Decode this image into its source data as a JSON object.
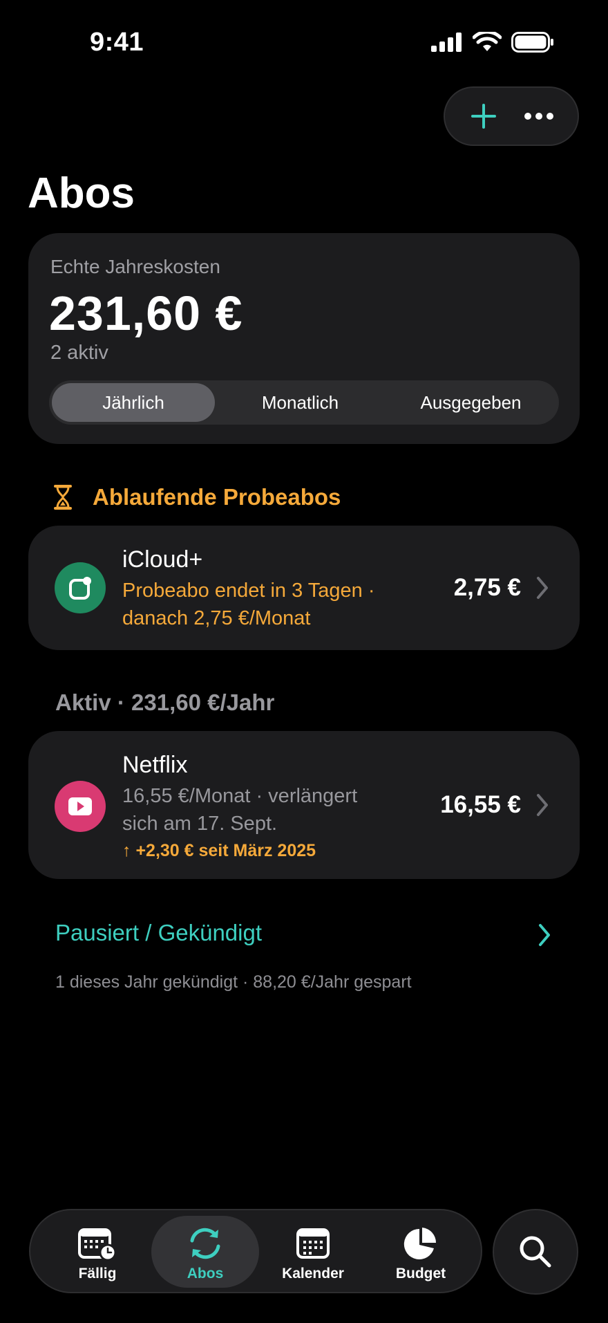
{
  "status_bar": {
    "time": "9:41"
  },
  "header": {
    "title": "Abos"
  },
  "summary": {
    "label": "Echte Jahreskosten",
    "amount": "231,60 €",
    "active_count": "2 aktiv",
    "segments": [
      "Jährlich",
      "Monatlich",
      "Ausgegeben"
    ],
    "selected_segment": "Jährlich"
  },
  "trials": {
    "title": "Ablaufende Probeabos",
    "items": [
      {
        "name": "iCloud+",
        "line1": "Probeabo endet in 3 Tagen ·",
        "line2": "danach 2,75 €/Monat",
        "price": "2,75 €",
        "icon": "icloud-icon",
        "color": "#1f8a5f"
      }
    ]
  },
  "active": {
    "title": "Aktiv · 231,60 €/Jahr",
    "items": [
      {
        "name": "Netflix",
        "line1": "16,55 €/Monat · verlängert",
        "line2": "sich am 17. Sept.",
        "increase": "↑ +2,30 € seit März 2025",
        "price": "16,55 €",
        "icon": "play-icon",
        "color": "#d93a72"
      }
    ]
  },
  "paused": {
    "label": "Pausiert / Gekündigt",
    "note": "1 dieses Jahr gekündigt · 88,20 €/Jahr gespart"
  },
  "tabbar": {
    "tabs": [
      {
        "label": "Fällig",
        "icon": "calendar-clock-icon"
      },
      {
        "label": "Abos",
        "icon": "refresh-icon"
      },
      {
        "label": "Kalender",
        "icon": "calendar-icon"
      },
      {
        "label": "Budget",
        "icon": "pie-chart-icon"
      }
    ],
    "active": "Abos"
  },
  "colors": {
    "accent": "#3ecfc0",
    "warning": "#f5a93a",
    "card": "#1c1c1e",
    "background": "#000000"
  }
}
